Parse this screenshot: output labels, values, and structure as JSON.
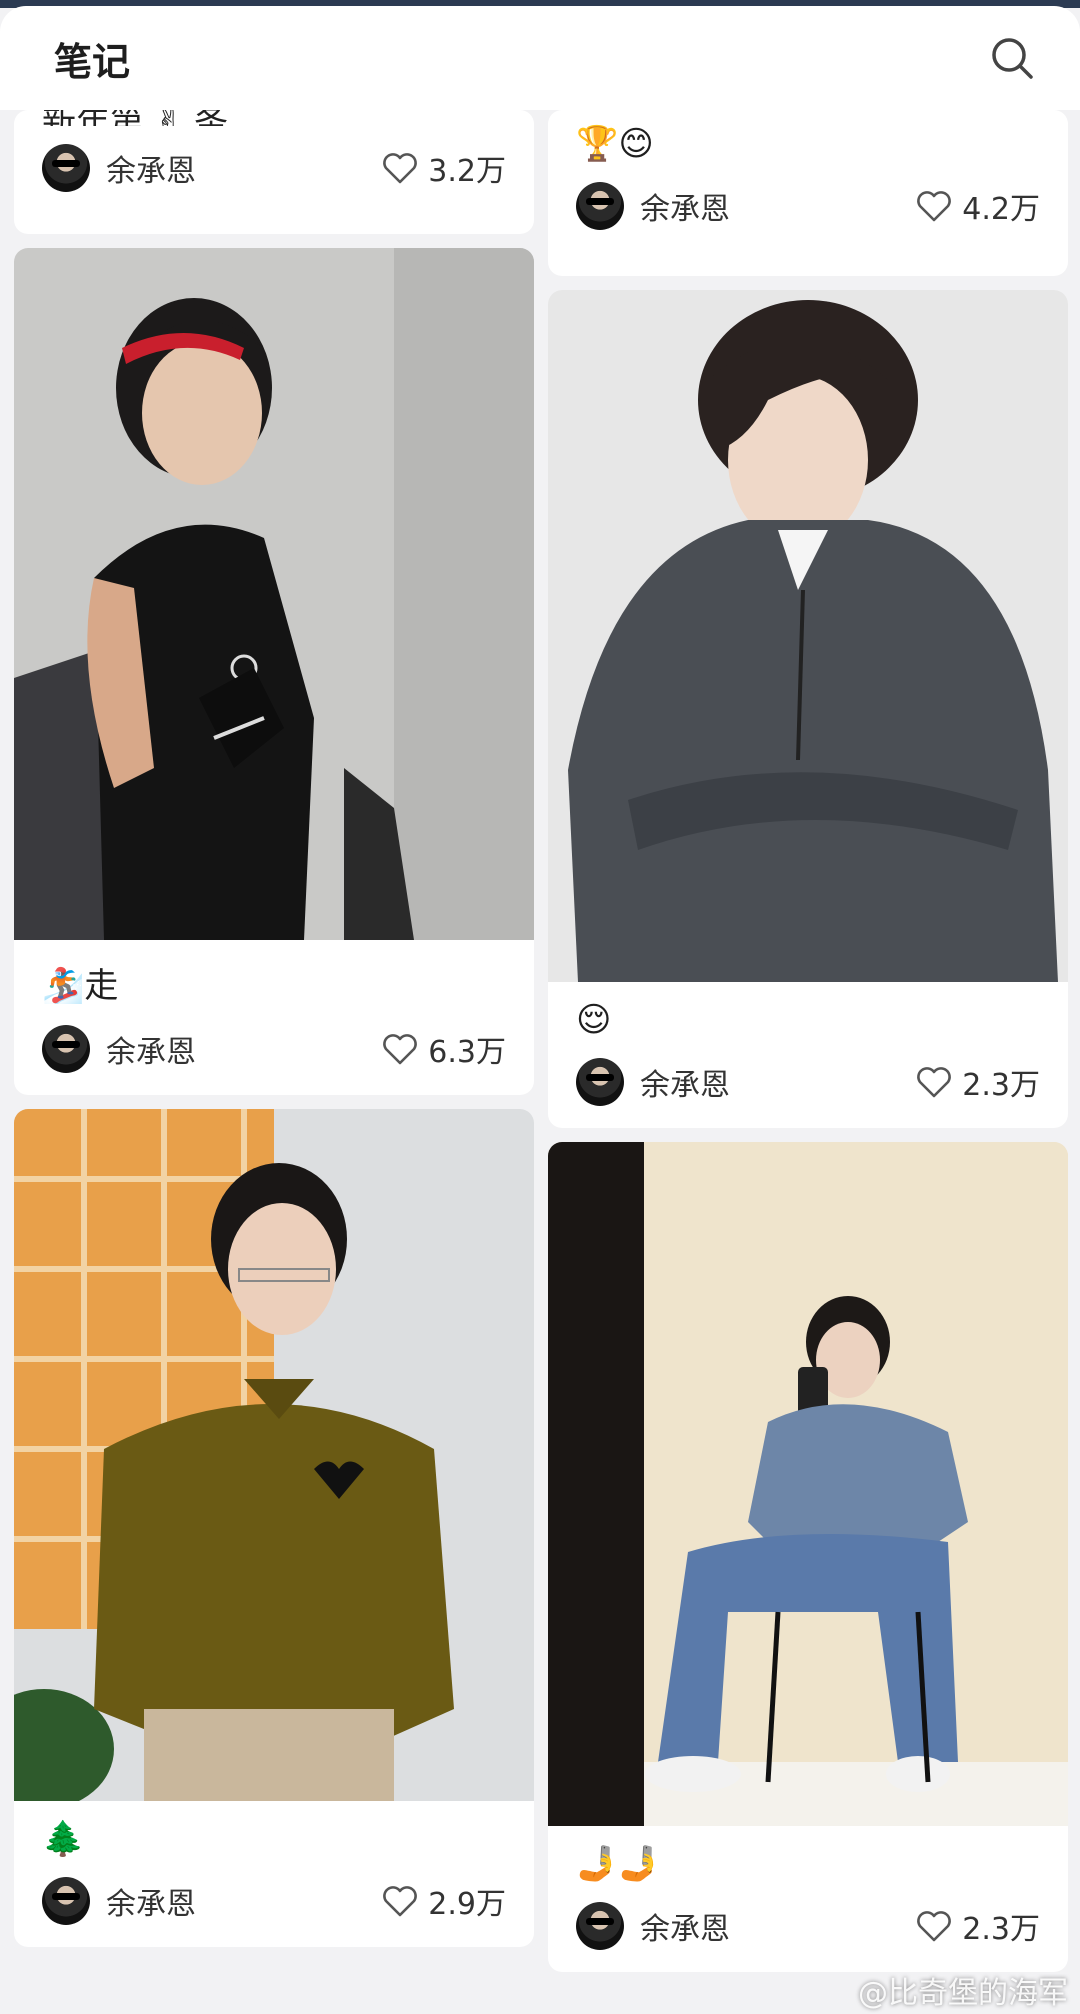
{
  "header": {
    "title": "笔记"
  },
  "cards_left": [
    {
      "title": "新年第 ✌ 条",
      "author": "余承恩",
      "likes": "3.2万"
    },
    {
      "title": "🏂走",
      "author": "余承恩",
      "likes": "6.3万"
    },
    {
      "title": "🌲",
      "author": "余承恩",
      "likes": "2.9万"
    }
  ],
  "cards_right": [
    {
      "title": "🏆😊",
      "author": "余承恩",
      "likes": "4.2万"
    },
    {
      "title": "😌",
      "author": "余承恩",
      "likes": "2.3万"
    },
    {
      "title": "🤳🤳",
      "author": "余承恩",
      "likes": "2.3万"
    }
  ],
  "watermark": "@比奇堡的海军",
  "colors": {
    "background": "#f2f2f4",
    "card": "#ffffff",
    "topbar": "#2b3a52"
  }
}
